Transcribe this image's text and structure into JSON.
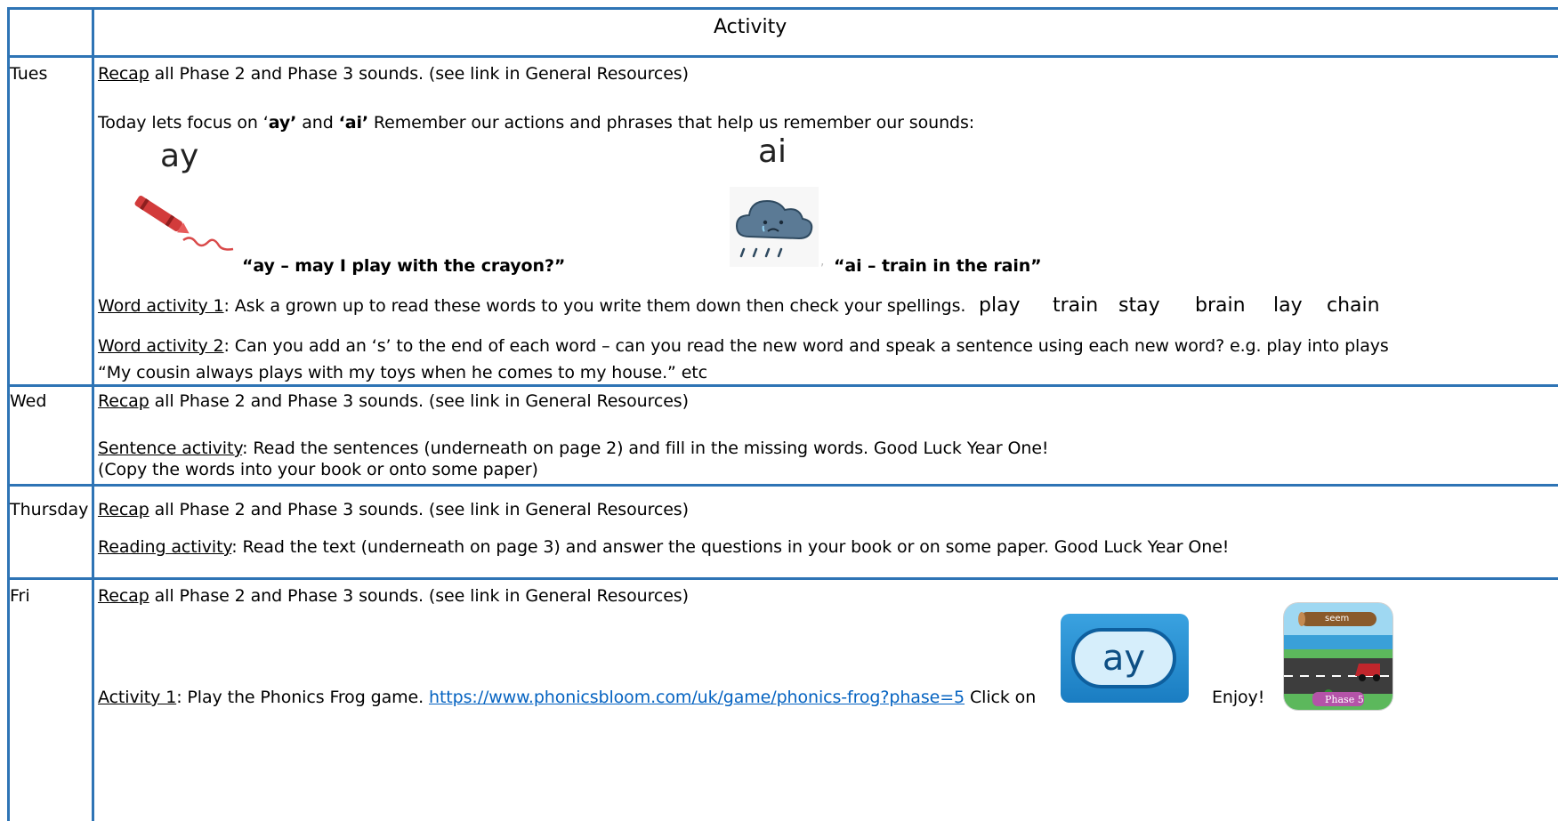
{
  "header": {
    "activity": "Activity"
  },
  "rows": {
    "tues": {
      "day": "Tues",
      "recap_link": "Recap",
      "recap_rest": " all Phase 2 and Phase 3 sounds. (see link in General Resources)",
      "focus_pre": "Today lets focus on  ‘",
      "focus_ay": "ay’",
      "focus_and": " and ",
      "focus_ai": "‘ai’",
      "focus_post": "  Remember our actions and phrases that help us remember our sounds:",
      "sound_ay": "ay",
      "sound_ai": "ai",
      "phrase_ay": "“ay – may I play with the crayon?”",
      "phrase_ai_prefix": ",",
      "phrase_ai": "“ai – train in the rain”",
      "word1_label": "Word activity 1",
      "word1_text": ": Ask a grown up to read these words to you write them down then check your spellings. ",
      "words": [
        "play",
        "train",
        "stay",
        "brain",
        "lay",
        "chain"
      ],
      "word2_label": "Word activity 2",
      "word2_colon": ":",
      "word2_text": " Can you add an ‘s’ to the end of each word – can you read the new word and speak a sentence using each new word? e.g. play into plays",
      "word2_example": "“My cousin always plays with my toys when he comes to my house.”     etc"
    },
    "wed": {
      "day": "Wed",
      "recap_link": "Recap",
      "recap_rest": " all Phase 2 and Phase 3 sounds. (see link in General Resources)",
      "sentence_label": "Sentence activity",
      "sentence_text": ": Read the sentences (underneath on page 2) and fill in the missing words. Good Luck Year One!",
      "sentence_note": "(Copy the words into your book or onto some paper)"
    },
    "thursday": {
      "day": "Thursday",
      "recap_link": "Recap",
      "recap_rest": " all Phase 2 and Phase 3 sounds. (see link in General Resources)",
      "reading_label": "Reading activity",
      "reading_text": ": Read the text (underneath on page 3) and answer the questions in your book or on some paper.  Good Luck Year One!"
    },
    "fri": {
      "day": "Fri",
      "recap_link": "Recap",
      "recap_rest": " all Phase 2 and Phase 3 sounds. (see link in General Resources)",
      "activity1_label": "Activity 1",
      "activity1_text": ": Play the Phonics Frog game. ",
      "activity1_url": "https://www.phonicsbloom.com/uk/game/phonics-frog?phase=5",
      "click_on": " Click on ",
      "card_label": "ay",
      "enjoy": "Enjoy!",
      "game_log_word": "seem",
      "game_badge": "Phase 5"
    }
  }
}
